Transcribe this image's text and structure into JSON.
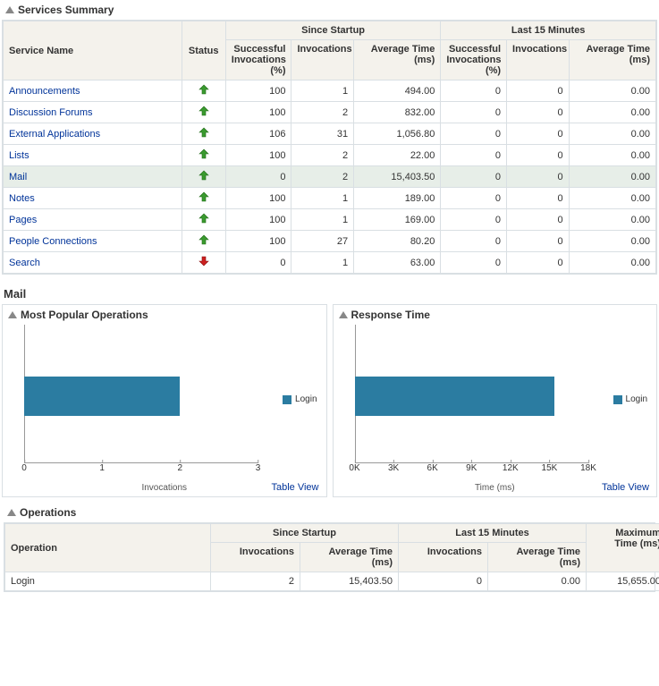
{
  "summary": {
    "title": "Services Summary",
    "cols": {
      "service": "Service Name",
      "status": "Status",
      "group_startup": "Since Startup",
      "group_last15": "Last 15 Minutes",
      "succ": "Successful Invocations (%)",
      "inv": "Invocations",
      "avg": "Average Time (ms)"
    },
    "rows": [
      {
        "name": "Announcements",
        "status": "up",
        "s_succ": "100",
        "s_inv": "1",
        "s_avg": "494.00",
        "l_succ": "0",
        "l_inv": "0",
        "l_avg": "0.00"
      },
      {
        "name": "Discussion Forums",
        "status": "up",
        "s_succ": "100",
        "s_inv": "2",
        "s_avg": "832.00",
        "l_succ": "0",
        "l_inv": "0",
        "l_avg": "0.00"
      },
      {
        "name": "External Applications",
        "status": "up",
        "s_succ": "106",
        "s_inv": "31",
        "s_avg": "1,056.80",
        "l_succ": "0",
        "l_inv": "0",
        "l_avg": "0.00"
      },
      {
        "name": "Lists",
        "status": "up",
        "s_succ": "100",
        "s_inv": "2",
        "s_avg": "22.00",
        "l_succ": "0",
        "l_inv": "0",
        "l_avg": "0.00"
      },
      {
        "name": "Mail",
        "status": "up",
        "s_succ": "0",
        "s_inv": "2",
        "s_avg": "15,403.50",
        "l_succ": "0",
        "l_inv": "0",
        "l_avg": "0.00",
        "selected": true
      },
      {
        "name": "Notes",
        "status": "up",
        "s_succ": "100",
        "s_inv": "1",
        "s_avg": "189.00",
        "l_succ": "0",
        "l_inv": "0",
        "l_avg": "0.00"
      },
      {
        "name": "Pages",
        "status": "up",
        "s_succ": "100",
        "s_inv": "1",
        "s_avg": "169.00",
        "l_succ": "0",
        "l_inv": "0",
        "l_avg": "0.00"
      },
      {
        "name": "People Connections",
        "status": "up",
        "s_succ": "100",
        "s_inv": "27",
        "s_avg": "80.20",
        "l_succ": "0",
        "l_inv": "0",
        "l_avg": "0.00"
      },
      {
        "name": "Search",
        "status": "down",
        "s_succ": "0",
        "s_inv": "1",
        "s_avg": "63.00",
        "l_succ": "0",
        "l_inv": "0",
        "l_avg": "0.00"
      }
    ]
  },
  "detail_heading": "Mail",
  "chart_popular": {
    "title": "Most Popular Operations",
    "legend": "Login",
    "xlabel": "Invocations",
    "ticks": [
      "0",
      "1",
      "2",
      "3"
    ],
    "table_view": "Table View"
  },
  "chart_response": {
    "title": "Response Time",
    "legend": "Login",
    "xlabel": "Time (ms)",
    "ticks": [
      "0K",
      "3K",
      "6K",
      "9K",
      "12K",
      "15K",
      "18K"
    ],
    "table_view": "Table View"
  },
  "chart_data": [
    {
      "type": "bar",
      "orientation": "horizontal",
      "title": "Most Popular Operations",
      "series": [
        {
          "name": "Login",
          "values": [
            2
          ]
        }
      ],
      "categories": [
        "Login"
      ],
      "xlabel": "Invocations",
      "ylabel": "",
      "xlim": [
        0,
        3
      ]
    },
    {
      "type": "bar",
      "orientation": "horizontal",
      "title": "Response Time",
      "series": [
        {
          "name": "Login",
          "values": [
            15403.5
          ]
        }
      ],
      "categories": [
        "Login"
      ],
      "xlabel": "Time (ms)",
      "ylabel": "",
      "xlim": [
        0,
        18000
      ]
    }
  ],
  "ops": {
    "title": "Operations",
    "cols": {
      "op": "Operation",
      "group_startup": "Since Startup",
      "group_last15": "Last 15 Minutes",
      "inv": "Invocations",
      "avg": "Average Time (ms)",
      "max": "Maximum Time (ms)"
    },
    "rows": [
      {
        "op": "Login",
        "s_inv": "2",
        "s_avg": "15,403.50",
        "l_inv": "0",
        "l_avg": "0.00",
        "max": "15,655.00"
      }
    ]
  }
}
